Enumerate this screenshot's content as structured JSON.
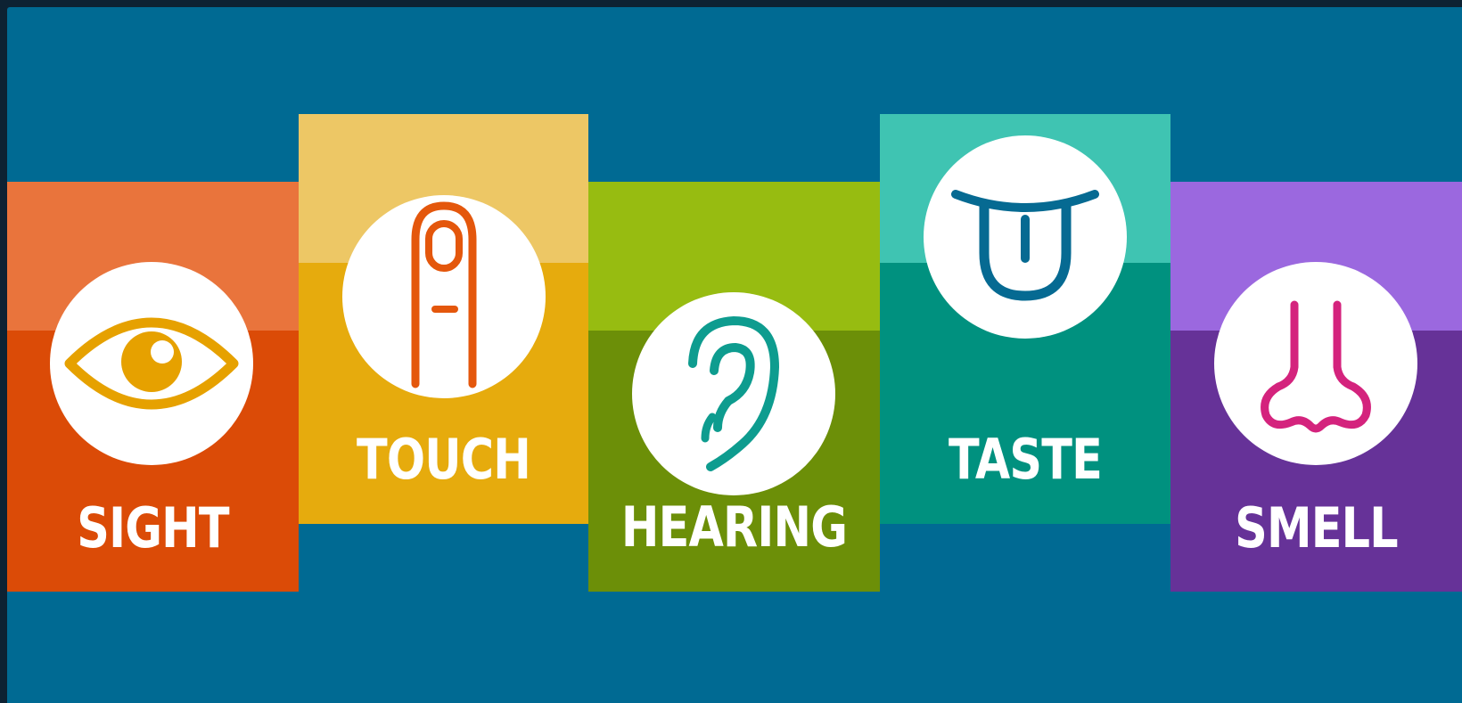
{
  "senses": [
    {
      "label": "SIGHT",
      "icon": "eye-icon",
      "top_color": "#e9743c",
      "bottom_color": "#db4b07",
      "icon_color": "#e6a100"
    },
    {
      "label": "TOUCH",
      "icon": "finger-icon",
      "top_color": "#edc765",
      "bottom_color": "#e6ab0d",
      "icon_color": "#e4570c"
    },
    {
      "label": "HEARING",
      "icon": "ear-icon",
      "top_color": "#97bc11",
      "bottom_color": "#6c8f08",
      "icon_color": "#0e9c8f"
    },
    {
      "label": "TASTE",
      "icon": "tongue-icon",
      "top_color": "#3fc4b2",
      "bottom_color": "#00917f",
      "icon_color": "#066a92"
    },
    {
      "label": "SMELL",
      "icon": "nose-icon",
      "top_color": "#9b68df",
      "bottom_color": "#663298",
      "icon_color": "#d4237d"
    }
  ],
  "background_color": "#006a93"
}
